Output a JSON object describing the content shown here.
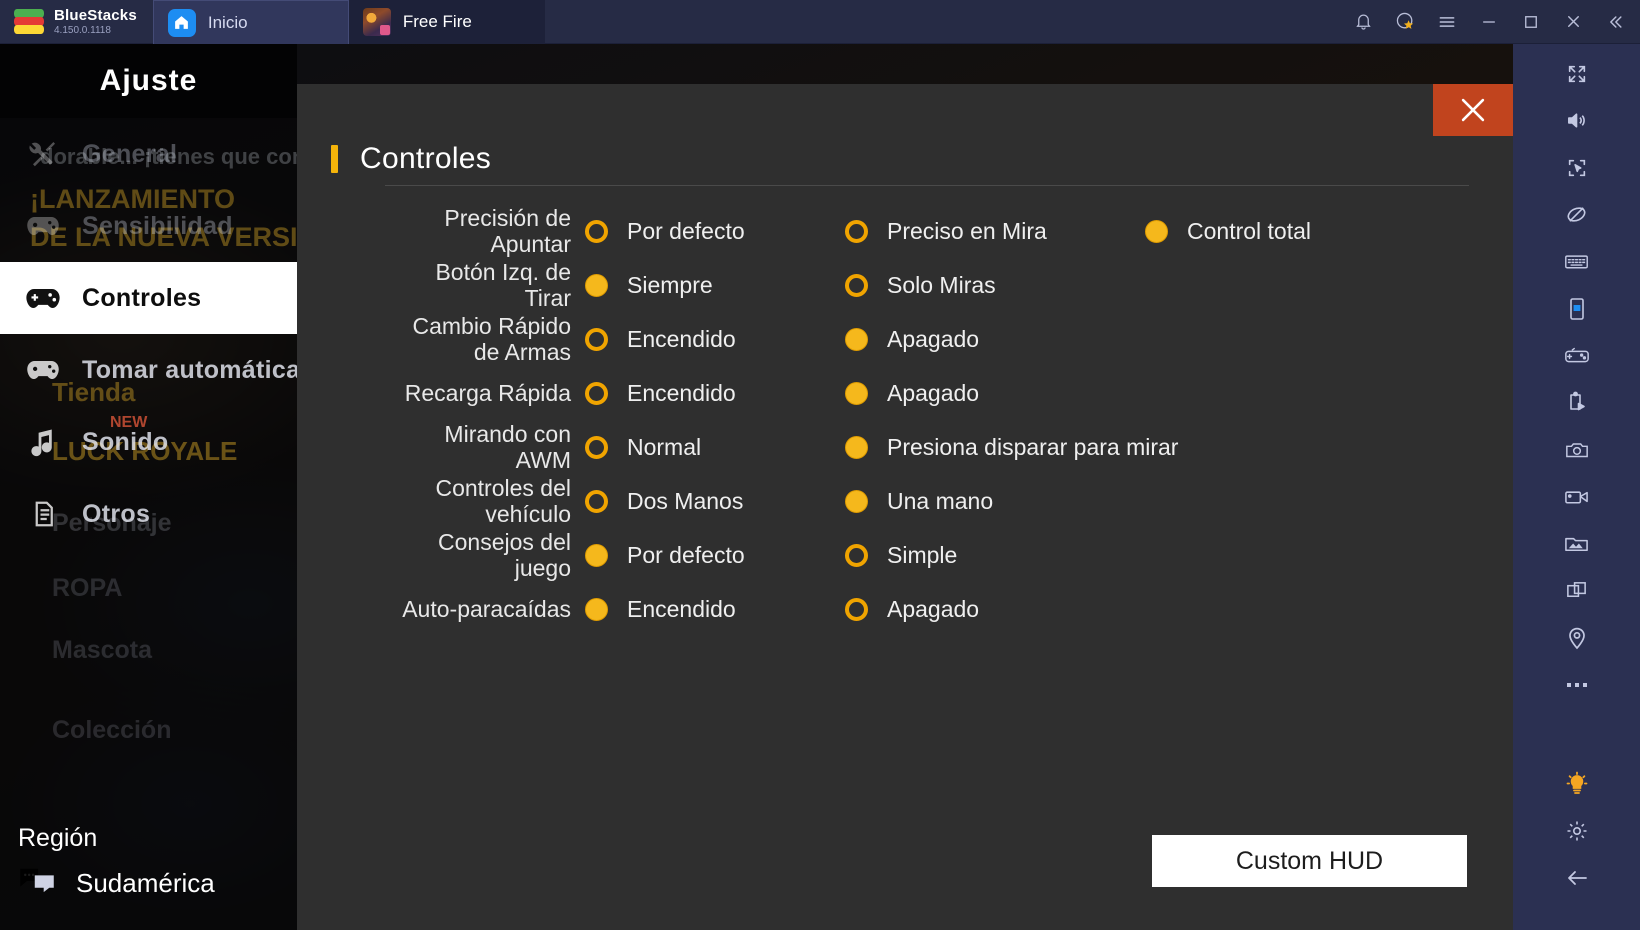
{
  "titlebar": {
    "brand": "BlueStacks",
    "version": "4.150.0.1118",
    "tabs": [
      {
        "label": "Inicio",
        "icon": "home-icon",
        "active": false
      },
      {
        "label": "Free Fire",
        "icon": "free-fire-app-icon",
        "active": true
      }
    ],
    "icons": [
      "bell-icon",
      "star-badge-icon",
      "hamburger-menu-icon",
      "minimize-icon",
      "maximize-icon",
      "close-icon",
      "collapse-left-icon"
    ]
  },
  "sidebar": {
    "title": "Ajuste",
    "items": [
      {
        "label": "General",
        "icon": "tools-icon",
        "state": "dim"
      },
      {
        "label": "Sensibilidad",
        "icon": "gamepad-icon",
        "state": "dim"
      },
      {
        "label": "Controles",
        "icon": "gamepad-icon",
        "state": "selected"
      },
      {
        "label": "Tomar automáticam",
        "icon": "gamepad-icon",
        "state": "normal"
      },
      {
        "label": "Sonido",
        "icon": "music-note-icon",
        "state": "normal"
      },
      {
        "label": "Otros",
        "icon": "document-icon",
        "state": "normal"
      }
    ],
    "ghost_labels": [
      "dorable... ¡tienes que conoc",
      "¡LANZAMIENTO",
      "DE LA NUEVA VERSIÓN!",
      "Tienda",
      "LUCK ROYALE",
      "Personaje",
      "ROPA",
      "Mascota",
      "Colección",
      "NEW"
    ],
    "region": {
      "label": "Región",
      "value": "Sudamérica",
      "icon": "chat-bubbles-icon"
    }
  },
  "panel": {
    "title": "Controles",
    "close_icon": "close-icon",
    "hud_button": "Custom HUD",
    "accent": "#f5b40a",
    "radio_color": "#f0a400",
    "rows": [
      {
        "label": "Precisión de Apuntar",
        "options": [
          {
            "label": "Por defecto",
            "selected": false
          },
          {
            "label": "Preciso en Mira",
            "selected": false
          },
          {
            "label": "Control total",
            "selected": true
          }
        ]
      },
      {
        "label": "Botón Izq. de Tirar",
        "options": [
          {
            "label": "Siempre",
            "selected": true
          },
          {
            "label": "Solo Miras",
            "selected": false
          }
        ]
      },
      {
        "label": "Cambio Rápido de Armas",
        "options": [
          {
            "label": "Encendido",
            "selected": false
          },
          {
            "label": "Apagado",
            "selected": true
          }
        ]
      },
      {
        "label": "Recarga Rápida",
        "options": [
          {
            "label": "Encendido",
            "selected": false
          },
          {
            "label": "Apagado",
            "selected": true
          }
        ]
      },
      {
        "label": "Mirando con AWM",
        "options": [
          {
            "label": "Normal",
            "selected": false
          },
          {
            "label": "Presiona disparar para mirar",
            "selected": true
          }
        ]
      },
      {
        "label": "Controles del vehículo",
        "options": [
          {
            "label": "Dos Manos",
            "selected": false
          },
          {
            "label": "Una mano",
            "selected": true
          }
        ]
      },
      {
        "label": "Consejos del juego",
        "options": [
          {
            "label": "Por defecto",
            "selected": true
          },
          {
            "label": "Simple",
            "selected": false
          }
        ]
      },
      {
        "label": "Auto-paracaídas",
        "options": [
          {
            "label": "Encendido",
            "selected": true
          },
          {
            "label": "Apagado",
            "selected": false
          }
        ]
      }
    ]
  },
  "rail": {
    "icons": [
      "fullscreen-icon",
      "volume-icon",
      "cursor-target-icon",
      "eye-slash-icon",
      "keyboard-icon",
      "device-phone-icon",
      "gamepad-settings-icon",
      "script-play-icon",
      "camera-icon",
      "video-record-icon",
      "gallery-icon",
      "multi-instance-icon",
      "location-pin-icon",
      "more-dots-icon",
      "lightbulb-icon",
      "gear-icon",
      "back-arrow-icon"
    ]
  }
}
